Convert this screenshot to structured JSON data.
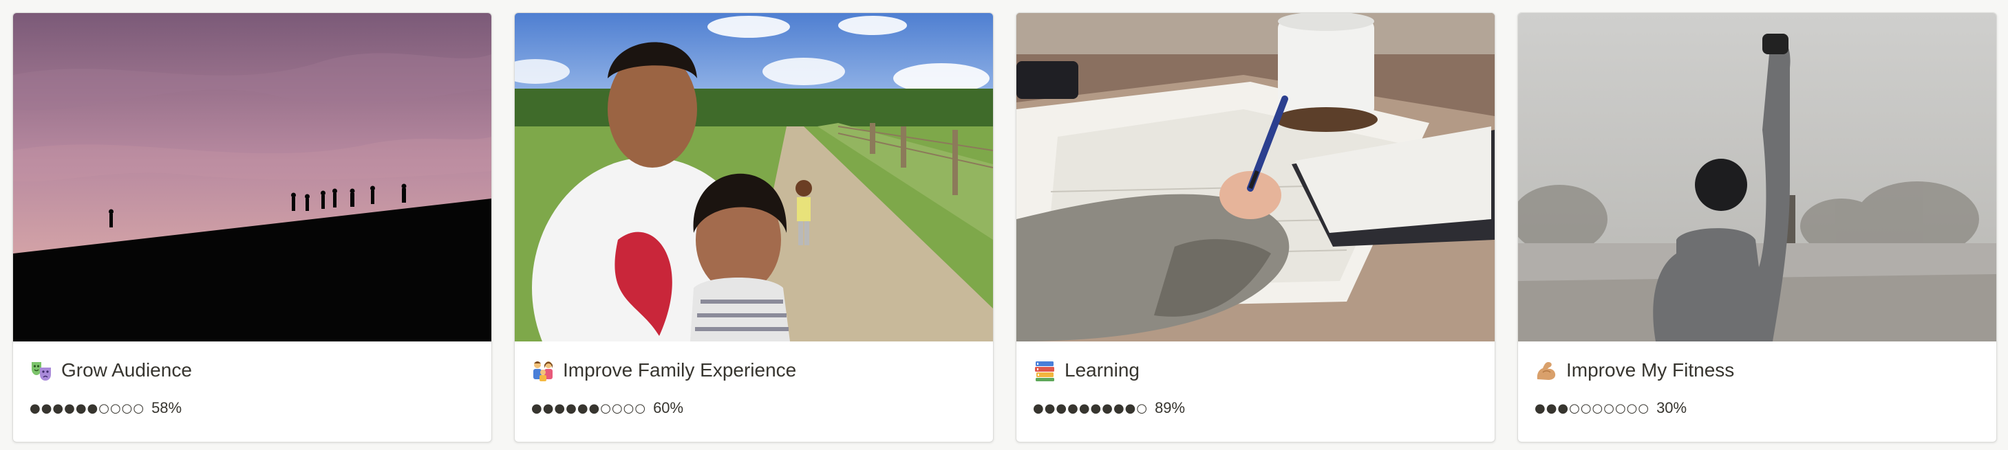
{
  "cards": [
    {
      "title": "Grow Audience",
      "emoji": "theater-masks-icon",
      "progress": 0.58,
      "dots": "●●●●●●○○○○",
      "percent": "58%"
    },
    {
      "title": "Improve Family Experience",
      "emoji": "family-icon",
      "progress": 0.6,
      "dots": "●●●●●●○○○○",
      "percent": "60%"
    },
    {
      "title": "Learning",
      "emoji": "books-icon",
      "progress": 0.89,
      "dots": "●●●●●●●●●○",
      "percent": "89%"
    },
    {
      "title": "Improve My Fitness",
      "emoji": "flexed-biceps-icon",
      "progress": 0.3,
      "dots": "●●●○○○○○○○",
      "percent": "30%"
    }
  ]
}
